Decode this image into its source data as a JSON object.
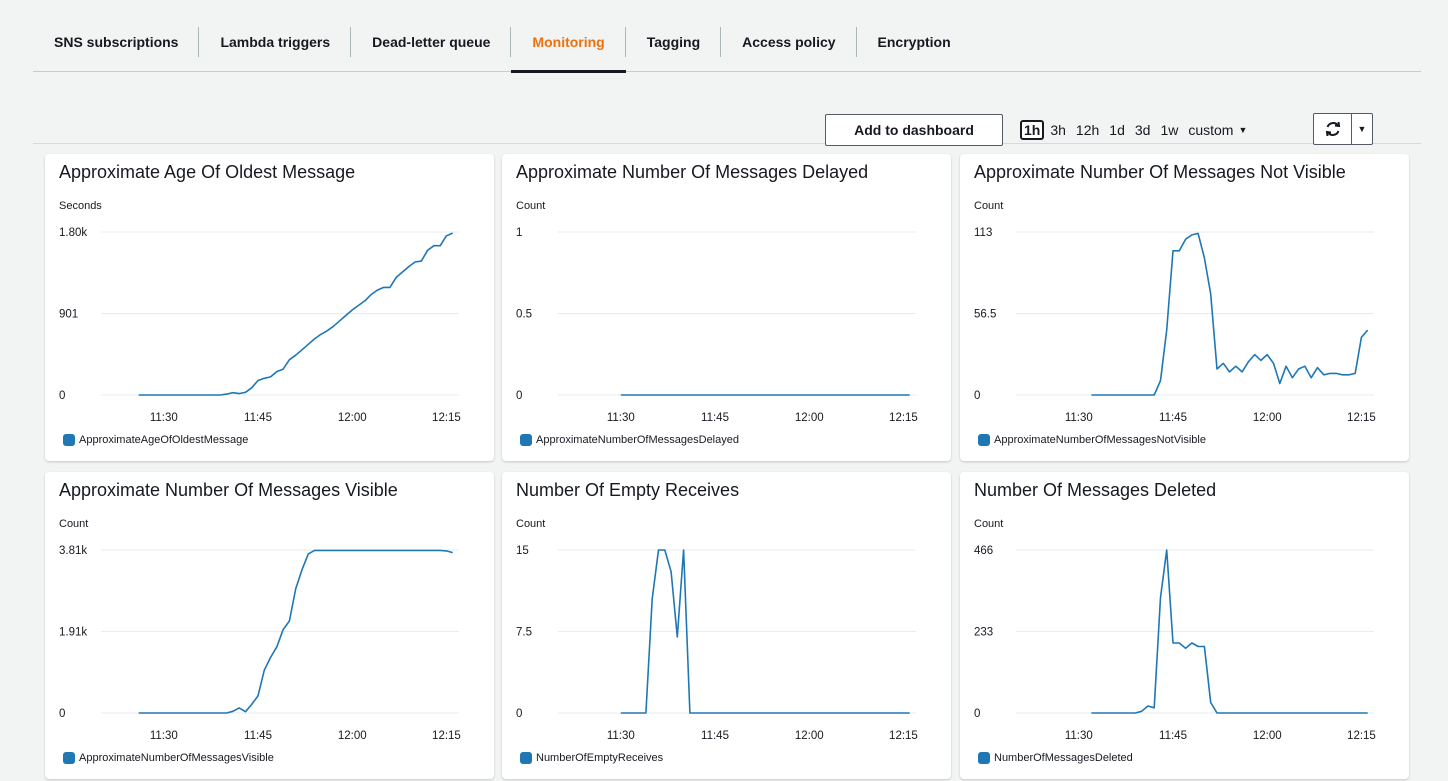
{
  "tabs": [
    {
      "label": "SNS subscriptions",
      "active": false
    },
    {
      "label": "Lambda triggers",
      "active": false
    },
    {
      "label": "Dead-letter queue",
      "active": false
    },
    {
      "label": "Monitoring",
      "active": true
    },
    {
      "label": "Tagging",
      "active": false
    },
    {
      "label": "Access policy",
      "active": false
    },
    {
      "label": "Encryption",
      "active": false
    }
  ],
  "toolbar": {
    "add_to_dashboard_label": "Add to dashboard",
    "time_ranges": [
      "1h",
      "3h",
      "12h",
      "1d",
      "3d",
      "1w"
    ],
    "selected_range": "1h",
    "custom_label": "custom",
    "refresh_icon": "refresh-icon",
    "refresh_menu_icon": "caret-down-icon"
  },
  "colors": {
    "active_tab": "#ec7211",
    "series": "#1f77b4",
    "grid": "#e9ebed"
  },
  "chart_data": [
    {
      "type": "line",
      "title": "Approximate Age Of Oldest Message",
      "ylabel": "Seconds",
      "ytick_labels": [
        "0",
        "901",
        "1.80k"
      ],
      "ylim": [
        0,
        1802
      ],
      "xtick_labels": [
        "11:30",
        "11:45",
        "12:00",
        "12:15"
      ],
      "xtick_minutes": [
        30,
        45,
        60,
        75
      ],
      "series": [
        {
          "name": "ApproximateAgeOfOldestMessage",
          "x": [
            26,
            27,
            28,
            29,
            30,
            31,
            32,
            33,
            34,
            35,
            36,
            37,
            38,
            39,
            40,
            41,
            42,
            43,
            44,
            45,
            46,
            47,
            48,
            49,
            50,
            51,
            52,
            53,
            54,
            55,
            56,
            57,
            58,
            59,
            60,
            61,
            62,
            63,
            64,
            65,
            66,
            67,
            68,
            69,
            70,
            71,
            72,
            73,
            74,
            75,
            76
          ],
          "y": [
            0,
            0,
            0,
            0,
            0,
            0,
            0,
            0,
            0,
            0,
            0,
            0,
            0,
            0,
            10,
            25,
            15,
            30,
            80,
            160,
            185,
            200,
            260,
            285,
            390,
            440,
            500,
            560,
            620,
            670,
            710,
            760,
            820,
            880,
            940,
            990,
            1040,
            1110,
            1160,
            1190,
            1190,
            1300,
            1360,
            1420,
            1470,
            1480,
            1600,
            1650,
            1650,
            1760,
            1790
          ]
        }
      ]
    },
    {
      "type": "line",
      "title": "Approximate Number Of Messages Delayed",
      "ylabel": "Count",
      "ytick_labels": [
        "0",
        "0.5",
        "1"
      ],
      "ylim": [
        0,
        1
      ],
      "xtick_labels": [
        "11:30",
        "11:45",
        "12:00",
        "12:15"
      ],
      "xtick_minutes": [
        30,
        45,
        60,
        75
      ],
      "series": [
        {
          "name": "ApproximateNumberOfMessagesDelayed",
          "x": [
            30,
            76
          ],
          "y": [
            0,
            0
          ]
        }
      ]
    },
    {
      "type": "line",
      "title": "Approximate Number Of Messages Not Visible",
      "ylabel": "Count",
      "ytick_labels": [
        "0",
        "56.5",
        "113"
      ],
      "ylim": [
        0,
        113
      ],
      "xtick_labels": [
        "11:30",
        "11:45",
        "12:00",
        "12:15"
      ],
      "xtick_minutes": [
        30,
        45,
        60,
        75
      ],
      "series": [
        {
          "name": "ApproximateNumberOfMessagesNotVisible",
          "x": [
            32,
            33,
            34,
            35,
            36,
            37,
            38,
            39,
            40,
            41,
            42,
            43,
            44,
            45,
            46,
            47,
            48,
            49,
            50,
            51,
            52,
            53,
            54,
            55,
            56,
            57,
            58,
            59,
            60,
            61,
            62,
            63,
            64,
            65,
            66,
            67,
            68,
            69,
            70,
            71,
            72,
            73,
            74,
            75,
            76
          ],
          "y": [
            0,
            0,
            0,
            0,
            0,
            0,
            0,
            0,
            0,
            0,
            0,
            10,
            45,
            100,
            100,
            108,
            111,
            112,
            95,
            70,
            18,
            22,
            16,
            20,
            16,
            23,
            28,
            24,
            28,
            22,
            8,
            20,
            12,
            18,
            20,
            12,
            19,
            14,
            15,
            15,
            14,
            14,
            15,
            40,
            45
          ]
        }
      ]
    },
    {
      "type": "line",
      "title": "Approximate Number Of Messages Visible",
      "ylabel": "Count",
      "ytick_labels": [
        "0",
        "1.91k",
        "3.81k"
      ],
      "ylim": [
        0,
        3810
      ],
      "xtick_labels": [
        "11:30",
        "11:45",
        "12:00",
        "12:15"
      ],
      "xtick_minutes": [
        30,
        45,
        60,
        75
      ],
      "series": [
        {
          "name": "ApproximateNumberOfMessagesVisible",
          "x": [
            26,
            27,
            28,
            29,
            30,
            31,
            32,
            33,
            34,
            35,
            36,
            37,
            38,
            39,
            40,
            41,
            42,
            43,
            44,
            45,
            46,
            47,
            48,
            49,
            50,
            51,
            52,
            53,
            54,
            55,
            56,
            57,
            58,
            59,
            60,
            61,
            62,
            63,
            64,
            65,
            66,
            67,
            68,
            69,
            70,
            71,
            72,
            73,
            74,
            75,
            76
          ],
          "y": [
            0,
            0,
            0,
            0,
            0,
            0,
            0,
            0,
            0,
            0,
            0,
            0,
            0,
            0,
            0,
            40,
            120,
            30,
            200,
            400,
            1000,
            1300,
            1550,
            1950,
            2150,
            2900,
            3350,
            3720,
            3800,
            3800,
            3800,
            3800,
            3800,
            3800,
            3800,
            3800,
            3800,
            3800,
            3800,
            3800,
            3800,
            3800,
            3800,
            3800,
            3800,
            3800,
            3800,
            3800,
            3800,
            3790,
            3750
          ]
        }
      ]
    },
    {
      "type": "line",
      "title": "Number Of Empty Receives",
      "ylabel": "Count",
      "ytick_labels": [
        "0",
        "7.5",
        "15"
      ],
      "ylim": [
        0,
        15
      ],
      "xtick_labels": [
        "11:30",
        "11:45",
        "12:00",
        "12:15"
      ],
      "xtick_minutes": [
        30,
        45,
        60,
        75
      ],
      "series": [
        {
          "name": "NumberOfEmptyReceives",
          "x": [
            30,
            31,
            32,
            33,
            34,
            35,
            36,
            37,
            38,
            39,
            40,
            41,
            42,
            43,
            44,
            45,
            46,
            47,
            48,
            49,
            50,
            51,
            52,
            53,
            54,
            55,
            56,
            57,
            58,
            59,
            60,
            61,
            62,
            63,
            64,
            65,
            66,
            67,
            68,
            69,
            70,
            71,
            72,
            73,
            74,
            75,
            76
          ],
          "y": [
            0,
            0,
            0,
            0,
            0,
            10.5,
            15,
            15,
            13,
            7,
            15,
            0,
            0,
            0,
            0,
            0,
            0,
            0,
            0,
            0,
            0,
            0,
            0,
            0,
            0,
            0,
            0,
            0,
            0,
            0,
            0,
            0,
            0,
            0,
            0,
            0,
            0,
            0,
            0,
            0,
            0,
            0,
            0,
            0,
            0,
            0,
            0
          ]
        }
      ]
    },
    {
      "type": "line",
      "title": "Number Of Messages Deleted",
      "ylabel": "Count",
      "ytick_labels": [
        "0",
        "233",
        "466"
      ],
      "ylim": [
        0,
        466
      ],
      "xtick_labels": [
        "11:30",
        "11:45",
        "12:00",
        "12:15"
      ],
      "xtick_minutes": [
        30,
        45,
        60,
        75
      ],
      "series": [
        {
          "name": "NumberOfMessagesDeleted",
          "x": [
            32,
            33,
            34,
            35,
            36,
            37,
            38,
            39,
            40,
            41,
            42,
            43,
            44,
            45,
            46,
            47,
            48,
            49,
            50,
            51,
            52,
            53,
            54,
            55,
            56,
            57,
            58,
            59,
            60,
            61,
            62,
            63,
            64,
            65,
            66,
            67,
            68,
            69,
            70,
            71,
            72,
            73,
            74,
            75,
            76
          ],
          "y": [
            0,
            0,
            0,
            0,
            0,
            0,
            0,
            0,
            5,
            20,
            15,
            330,
            466,
            200,
            200,
            185,
            200,
            190,
            190,
            30,
            0,
            0,
            0,
            0,
            0,
            0,
            0,
            0,
            0,
            0,
            0,
            0,
            0,
            0,
            0,
            0,
            0,
            0,
            0,
            0,
            0,
            0,
            0,
            0,
            0
          ]
        }
      ]
    }
  ]
}
